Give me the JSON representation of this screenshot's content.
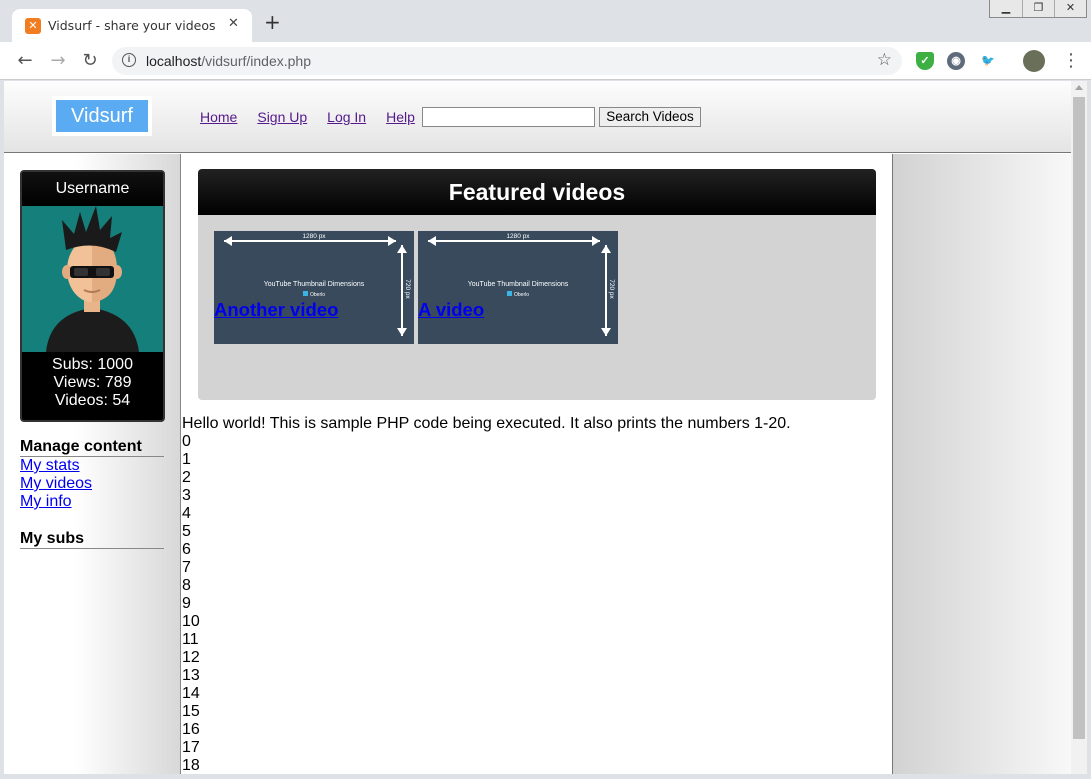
{
  "browser": {
    "tab_title": "Vidsurf - share your videos with the world",
    "tab_favicon": "xampp-icon",
    "url_host": "localhost",
    "url_path": "/vidsurf/index.php",
    "window_buttons": [
      "minimize",
      "restore",
      "close"
    ]
  },
  "site": {
    "logo_text": "Vidsurf",
    "nav": [
      "Home",
      "Sign Up",
      "Log In",
      "Help"
    ],
    "search_value": "",
    "search_button": "Search Videos"
  },
  "profile": {
    "username": "Username",
    "subs": "Subs: 1000",
    "views": "Views: 789",
    "videos": "Videos: 54"
  },
  "sidebar": {
    "manage_heading": "Manage content",
    "links": [
      "My stats",
      "My videos",
      "My info"
    ],
    "subs_heading": "My subs"
  },
  "featured": {
    "heading": "Featured videos",
    "videos": [
      {
        "title": "Another video",
        "thumb_caption": "YouTube Thumbnail Dimensions",
        "thumb_brand": "Oberlo",
        "width_label": "1280 px",
        "height_label": "720 px"
      },
      {
        "title": "A video",
        "thumb_caption": "YouTube Thumbnail Dimensions",
        "thumb_brand": "Oberlo",
        "width_label": "1280 px",
        "height_label": "720 px"
      }
    ]
  },
  "php_output": {
    "message": "Hello world! This is sample PHP code being executed. It also prints the numbers 1-20.",
    "numbers": [
      "0",
      "1",
      "2",
      "3",
      "4",
      "5",
      "6",
      "7",
      "8",
      "9",
      "10",
      "11",
      "12",
      "13",
      "14",
      "15",
      "16",
      "17",
      "18"
    ]
  },
  "colors": {
    "logo_bg": "#5aabf2",
    "avatar_bg": "#157f7b",
    "thumb_bg": "#384a5c",
    "link": "#0000ee",
    "visited_link": "#551a8b"
  }
}
